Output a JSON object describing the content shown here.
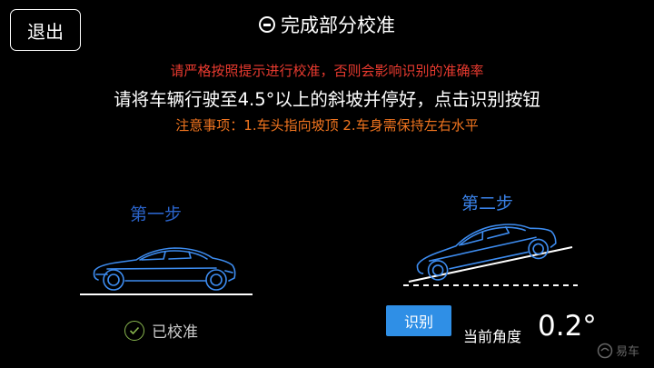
{
  "header": {
    "exit_label": "退出",
    "title": "完成部分校准"
  },
  "messages": {
    "warning": "请严格按照提示进行校准，否则会影响识别的准确率",
    "instruction": "请将车辆行驶至4.5°以上的斜坡并停好，点击识别按钮",
    "note": "注意事项：1.车头指向坡顶  2.车身需保持左右水平"
  },
  "step1": {
    "title": "第一步",
    "status": "已校准"
  },
  "step2": {
    "title": "第二步",
    "button_label": "识别",
    "angle_label": "当前角度",
    "angle_value": "0.2°"
  },
  "watermark": {
    "text": "易车"
  },
  "colors": {
    "warning": "#e83a2f",
    "note": "#f0741f",
    "step1_title": "#2a63c9",
    "step2_title": "#3a82e8",
    "button": "#2f8fe6",
    "car_outline": "#3d8cf0",
    "check": "#8ab84f"
  },
  "icons": {
    "header": "minus-circle-icon",
    "status": "check-circle-icon"
  }
}
